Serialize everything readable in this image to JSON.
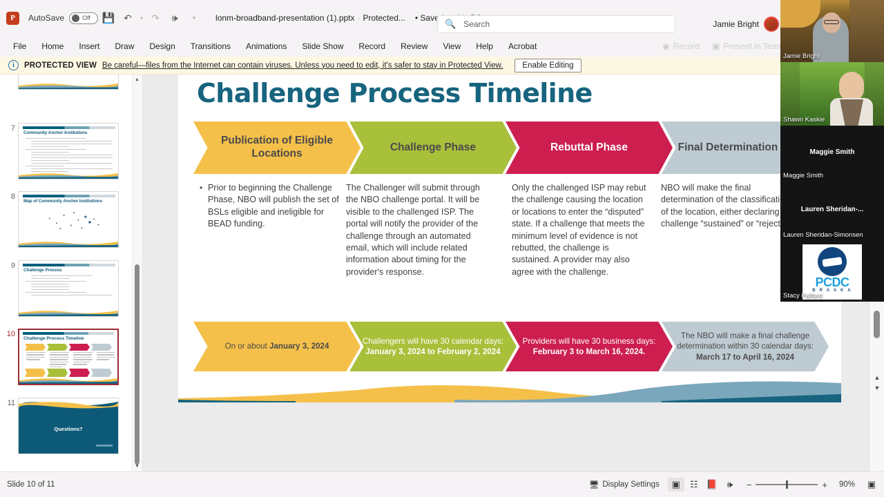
{
  "titlebar": {
    "app_icon": "powerpoint-icon",
    "app_letter": "P",
    "autosave_label": "AutoSave",
    "autosave_state": "Off",
    "icons": [
      "save-icon",
      "undo-icon",
      "redo-icon",
      "present-icon",
      "customize-quick-access-icon"
    ],
    "doc_name": "lonm-broadband-presentation (1).pptx",
    "separator": "·",
    "protected_tag": "Protected...",
    "save_state": "• Saved to this PC",
    "user_name": "Jamie Bright"
  },
  "search": {
    "placeholder": "Search",
    "icon": "search-icon"
  },
  "ribbon": {
    "tabs": [
      "File",
      "Home",
      "Insert",
      "Draw",
      "Design",
      "Transitions",
      "Animations",
      "Slide Show",
      "Record",
      "Review",
      "View",
      "Help",
      "Acrobat"
    ],
    "right_items": [
      {
        "label": "Record",
        "icon": "record-icon"
      },
      {
        "label": "Present in Teams",
        "icon": "teams-icon"
      }
    ]
  },
  "protected_view": {
    "icon": "info-icon",
    "label": "PROTECTED VIEW",
    "message": "Be careful—files from the Internet can contain viruses. Unless you need to edit, it's safer to stay in Protected View.",
    "button": "Enable Editing"
  },
  "thumbnails": [
    {
      "num": "7",
      "title": "Community Anchor Institutions",
      "kind": "text",
      "active": false
    },
    {
      "num": "8",
      "title": "Map of Community Anchor Institutions",
      "kind": "map",
      "active": false
    },
    {
      "num": "9",
      "title": "Challenge Process",
      "kind": "text",
      "active": false
    },
    {
      "num": "10",
      "title": "Challenge Process Timeline",
      "kind": "timeline",
      "active": true
    },
    {
      "num": "11",
      "title": "Questions?",
      "kind": "questions",
      "active": false
    }
  ],
  "slide": {
    "title": "Challenge Process Timeline",
    "phases": [
      {
        "label": "Publication of Eligible Locations",
        "color": "#f5c04a",
        "text_color": "#4a4a4a"
      },
      {
        "label": "Challenge Phase",
        "color": "#a8c03a",
        "text_color": "#4a4a4a"
      },
      {
        "label": "Rebuttal Phase",
        "color": "#cd1e50",
        "text_color": "#ffffff"
      },
      {
        "label": "Final Determination Phase",
        "color": "#bfcbd2",
        "text_color": "#4a4a4a"
      }
    ],
    "bodies": [
      {
        "bullet": "•",
        "text": "Prior to beginning the Challenge Phase, NBO will publish the set of BSLs eligible and ineligible for BEAD funding."
      },
      {
        "bullet": "",
        "text": "The Challenger will submit through the NBO challenge portal. It will be visible to the challenged ISP. The portal will notify the provider of the challenge through an automated email, which will include related information about timing for the provider's response."
      },
      {
        "bullet": "",
        "text": "Only the challenged ISP may rebut the challenge causing the location or locations to enter the “disputed” state. If a challenge that meets the minimum level of evidence is not rebutted, the challenge is sustained. A provider may also agree with the challenge."
      },
      {
        "bullet": "",
        "text": "NBO will make the final determination of the classification of the location, either declaring the challenge “sustained” or “rejected.”"
      }
    ],
    "dates": [
      {
        "prefix": "On or about ",
        "bold": "January 3, 2024",
        "suffix": "",
        "color": "#f5c04a",
        "text_color": "#4a4a4a"
      },
      {
        "prefix": "Challengers will have 30 calendar days: ",
        "bold": "January 3, 2024 to February 2, 2024",
        "suffix": "",
        "color": "#a8c03a",
        "text_color": "#ffffff"
      },
      {
        "prefix": "Providers will have 30 business days: ",
        "bold": "February 3 to March 16, 2024.",
        "suffix": "",
        "color": "#cd1e50",
        "text_color": "#ffffff"
      },
      {
        "prefix": "The NBO will make a final challenge determination within 30 calendar days: ",
        "bold": "March 17 to April 16, 2024",
        "suffix": "",
        "color": "#bfcbd2",
        "text_color": "#4a4a4a"
      }
    ],
    "title_color": "#17647f",
    "wave_colors": [
      "#f5c04a",
      "#7ba7bc",
      "#17647f"
    ]
  },
  "video_panel": {
    "participants": [
      {
        "name": "Jamie Bright",
        "type": "video",
        "name_pos": "bottom-left"
      },
      {
        "name": "Shawn Kaskie",
        "type": "video",
        "name_pos": "bottom-left"
      },
      {
        "name": "Maggie Smith",
        "type": "avatar-dark",
        "name_pos": "bottom-left",
        "center_name": "Maggie Smith"
      },
      {
        "name": "Lauren Sheridan-Simonsen",
        "type": "avatar-dark",
        "name_pos": "bottom-left",
        "center_name": "Lauren  Sheridan-..."
      },
      {
        "name": "Stacy Pafford",
        "type": "logo",
        "name_pos": "bottom-left",
        "logo_text": "PCDC",
        "logo_sub": "B R A S K A"
      }
    ]
  },
  "statusbar": {
    "slide_counter": "Slide 10 of 11",
    "display_settings": "Display Settings",
    "display_settings_icon": "display-settings-icon",
    "view_buttons": [
      "normal-view-icon",
      "slide-sorter-icon",
      "reading-view-icon",
      "slideshow-icon"
    ],
    "zoom_out": "−",
    "zoom_in": "+",
    "zoom_level": "90%",
    "fit_icon": "fit-slide-icon"
  }
}
